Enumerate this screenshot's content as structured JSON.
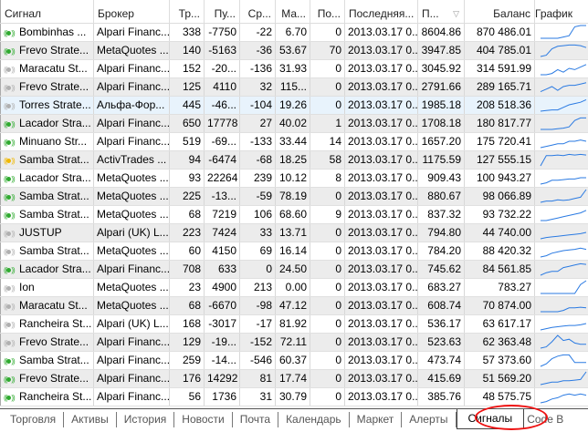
{
  "columns": [
    "Сигнал",
    "Брокер",
    "Тр...",
    "Пу...",
    "Ср...",
    "Ма...",
    "По...",
    "Последняя...",
    "П...",
    "Баланс",
    "График"
  ],
  "colors": {
    "active": "#2eaa2e",
    "inactive": "#b0b0b0",
    "warning": "#f0b800",
    "line": "#2a7ae2"
  },
  "rows": [
    {
      "status": "active",
      "signal": "Bombinhas ...",
      "broker": "Alpari Financ...",
      "tr": "338",
      "pu": "-7750",
      "sr": "-22",
      "ma": "6.70",
      "po": "0",
      "last": "2013.03.17 0...",
      "p": "8604.86",
      "balance": "870 486.01",
      "spark": [
        0,
        0,
        0,
        0,
        0.1,
        0.2,
        0.9,
        1,
        1
      ]
    },
    {
      "status": "active",
      "signal": "Frevo Strate...",
      "broker": "MetaQuotes ...",
      "tr": "140",
      "pu": "-5163",
      "sr": "-36",
      "ma": "53.67",
      "po": "70",
      "last": "2013.03.17 0...",
      "p": "3947.85",
      "balance": "404 785.01",
      "spark": [
        0,
        0.1,
        0.6,
        0.8,
        0.85,
        0.9,
        0.9,
        0.85,
        0.7
      ]
    },
    {
      "status": "inactive",
      "signal": "Maracatu St...",
      "broker": "Alpari Financ...",
      "tr": "152",
      "pu": "-20...",
      "sr": "-136",
      "ma": "31.93",
      "po": "0",
      "last": "2013.03.17 0...",
      "p": "3045.92",
      "balance": "314 591.99",
      "spark": [
        0,
        0,
        0.1,
        0.4,
        0.2,
        0.5,
        0.4,
        0.6,
        0.8
      ]
    },
    {
      "status": "inactive",
      "signal": "Frevo Strate...",
      "broker": "Alpari Financ...",
      "tr": "125",
      "pu": "4110",
      "sr": "32",
      "ma": "115...",
      "po": "0",
      "last": "2013.03.17 0...",
      "p": "2791.66",
      "balance": "289 165.71",
      "spark": [
        0.1,
        0.3,
        0.5,
        0.2,
        0.5,
        0.6,
        0.6,
        0.7,
        0.8
      ]
    },
    {
      "status": "inactive",
      "signal": "Torres Strate...",
      "broker": "Альфа-Фор...",
      "tr": "445",
      "pu": "-46...",
      "sr": "-104",
      "ma": "19.26",
      "po": "0",
      "last": "2013.03.17 0...",
      "p": "1985.18",
      "balance": "208 518.36",
      "spark": [
        0,
        0.05,
        0.1,
        0.1,
        0.3,
        0.5,
        0.6,
        0.7,
        0.9
      ]
    },
    {
      "status": "active",
      "signal": "Lacador Stra...",
      "broker": "Alpari Financ...",
      "tr": "650",
      "pu": "17778",
      "sr": "27",
      "ma": "40.02",
      "po": "1",
      "last": "2013.03.17 0...",
      "p": "1708.18",
      "balance": "180 817.77",
      "spark": [
        0,
        0,
        0,
        0.05,
        0.1,
        0.2,
        0.7,
        0.9,
        0.9
      ]
    },
    {
      "status": "active",
      "signal": "Minuano Str...",
      "broker": "Alpari Financ...",
      "tr": "519",
      "pu": "-69...",
      "sr": "-133",
      "ma": "33.44",
      "po": "14",
      "last": "2013.03.17 0...",
      "p": "1657.20",
      "balance": "175 720.41",
      "spark": [
        0,
        0.1,
        0.2,
        0.3,
        0.3,
        0.5,
        0.5,
        0.6,
        0.5
      ]
    },
    {
      "status": "warning",
      "signal": "Samba Strat...",
      "broker": "ActivTrades ...",
      "tr": "94",
      "pu": "-6474",
      "sr": "-68",
      "ma": "18.25",
      "po": "58",
      "last": "2013.03.17 0...",
      "p": "1175.59",
      "balance": "127 555.15",
      "spark": [
        0,
        0.8,
        0.8,
        0.85,
        0.8,
        0.9,
        0.85,
        0.9,
        0.85
      ]
    },
    {
      "status": "active",
      "signal": "Lacador Stra...",
      "broker": "MetaQuotes ...",
      "tr": "93",
      "pu": "22264",
      "sr": "239",
      "ma": "10.12",
      "po": "8",
      "last": "2013.03.17 0...",
      "p": "909.43",
      "balance": "100 943.27",
      "spark": [
        0,
        0.1,
        0.3,
        0.3,
        0.35,
        0.4,
        0.4,
        0.5,
        0.5
      ]
    },
    {
      "status": "active",
      "signal": "Samba Strat...",
      "broker": "MetaQuotes ...",
      "tr": "225",
      "pu": "-13...",
      "sr": "-59",
      "ma": "78.19",
      "po": "0",
      "last": "2013.03.17 0...",
      "p": "880.67",
      "balance": "98 066.89",
      "spark": [
        0,
        0.1,
        0.1,
        0.2,
        0.15,
        0.2,
        0.3,
        0.4,
        1
      ]
    },
    {
      "status": "active",
      "signal": "Samba Strat...",
      "broker": "MetaQuotes ...",
      "tr": "68",
      "pu": "7219",
      "sr": "106",
      "ma": "68.60",
      "po": "9",
      "last": "2013.03.17 0...",
      "p": "837.32",
      "balance": "93 732.22",
      "spark": [
        0,
        0,
        0.1,
        0.2,
        0.3,
        0.4,
        0.5,
        0.6,
        0.8
      ]
    },
    {
      "status": "inactive",
      "signal": "JUSTUP",
      "broker": "Alpari (UK) L...",
      "tr": "223",
      "pu": "7424",
      "sr": "33",
      "ma": "13.71",
      "po": "0",
      "last": "2013.03.17 0...",
      "p": "794.80",
      "balance": "44 740.00",
      "spark": [
        0,
        0.1,
        0.15,
        0.2,
        0.25,
        0.3,
        0.35,
        0.4,
        0.5
      ]
    },
    {
      "status": "inactive",
      "signal": "Samba Strat...",
      "broker": "MetaQuotes ...",
      "tr": "60",
      "pu": "4150",
      "sr": "69",
      "ma": "16.14",
      "po": "0",
      "last": "2013.03.17 0...",
      "p": "784.20",
      "balance": "88 420.32",
      "spark": [
        0,
        0.1,
        0.3,
        0.4,
        0.5,
        0.55,
        0.6,
        0.7,
        0.6
      ]
    },
    {
      "status": "active",
      "signal": "Lacador Stra...",
      "broker": "Alpari Financ...",
      "tr": "708",
      "pu": "633",
      "sr": "0",
      "ma": "24.50",
      "po": "0",
      "last": "2013.03.17 0...",
      "p": "745.62",
      "balance": "84 561.85",
      "spark": [
        0,
        0.2,
        0.3,
        0.3,
        0.6,
        0.7,
        0.8,
        0.9,
        0.85
      ]
    },
    {
      "status": "inactive",
      "signal": "Ion",
      "broker": "MetaQuotes ...",
      "tr": "23",
      "pu": "4900",
      "sr": "213",
      "ma": "0.00",
      "po": "0",
      "last": "2013.03.17 0...",
      "p": "683.27",
      "balance": "783.27",
      "spark": [
        0,
        0,
        0,
        0,
        0,
        0,
        0,
        0.7,
        1
      ]
    },
    {
      "status": "inactive",
      "signal": "Maracatu St...",
      "broker": "MetaQuotes ...",
      "tr": "68",
      "pu": "-6670",
      "sr": "-98",
      "ma": "47.12",
      "po": "0",
      "last": "2013.03.17 0...",
      "p": "608.74",
      "balance": "70 874.00",
      "spark": [
        0,
        0,
        0,
        0,
        0.1,
        0.3,
        0.3,
        0.35,
        0.3
      ]
    },
    {
      "status": "inactive",
      "signal": "Rancheira St...",
      "broker": "Alpari (UK) L...",
      "tr": "168",
      "pu": "-3017",
      "sr": "-17",
      "ma": "81.92",
      "po": "0",
      "last": "2013.03.17 0...",
      "p": "536.17",
      "balance": "63 617.17",
      "spark": [
        0,
        0.1,
        0.2,
        0.25,
        0.3,
        0.35,
        0.35,
        0.4,
        0.5
      ]
    },
    {
      "status": "inactive",
      "signal": "Frevo Strate...",
      "broker": "Alpari Financ...",
      "tr": "129",
      "pu": "-19...",
      "sr": "-152",
      "ma": "72.11",
      "po": "0",
      "last": "2013.03.17 0...",
      "p": "523.63",
      "balance": "62 363.48",
      "spark": [
        0,
        0.1,
        0.5,
        1,
        0.6,
        0.7,
        0.4,
        0.3,
        0.3
      ]
    },
    {
      "status": "active",
      "signal": "Samba Strat...",
      "broker": "Alpari Financ...",
      "tr": "259",
      "pu": "-14...",
      "sr": "-546",
      "ma": "60.37",
      "po": "0",
      "last": "2013.03.17 0...",
      "p": "473.74",
      "balance": "57 373.60",
      "spark": [
        0,
        0.2,
        0.6,
        0.8,
        0.9,
        0.9,
        0.3,
        0.3,
        0.3
      ]
    },
    {
      "status": "active",
      "signal": "Frevo Strate...",
      "broker": "Alpari Financ...",
      "tr": "176",
      "pu": "14292",
      "sr": "81",
      "ma": "17.74",
      "po": "0",
      "last": "2013.03.17 0...",
      "p": "415.69",
      "balance": "51 569.20",
      "spark": [
        0,
        0.1,
        0.2,
        0.2,
        0.3,
        0.3,
        0.35,
        0.4,
        1
      ]
    },
    {
      "status": "active",
      "signal": "Rancheira St...",
      "broker": "Alpari Financ...",
      "tr": "56",
      "pu": "1736",
      "sr": "31",
      "ma": "30.79",
      "po": "0",
      "last": "2013.03.17 0...",
      "p": "385.76",
      "balance": "48 575.75",
      "spark": [
        0,
        0.1,
        0.3,
        0.4,
        0.6,
        0.7,
        0.6,
        0.7,
        0.6
      ]
    }
  ],
  "tabs": [
    "Торговля",
    "Активы",
    "История",
    "Новости",
    "Почта",
    "Календарь",
    "Маркет",
    "Алерты",
    "Сигналы",
    "Code B"
  ],
  "active_tab": "Сигналы"
}
